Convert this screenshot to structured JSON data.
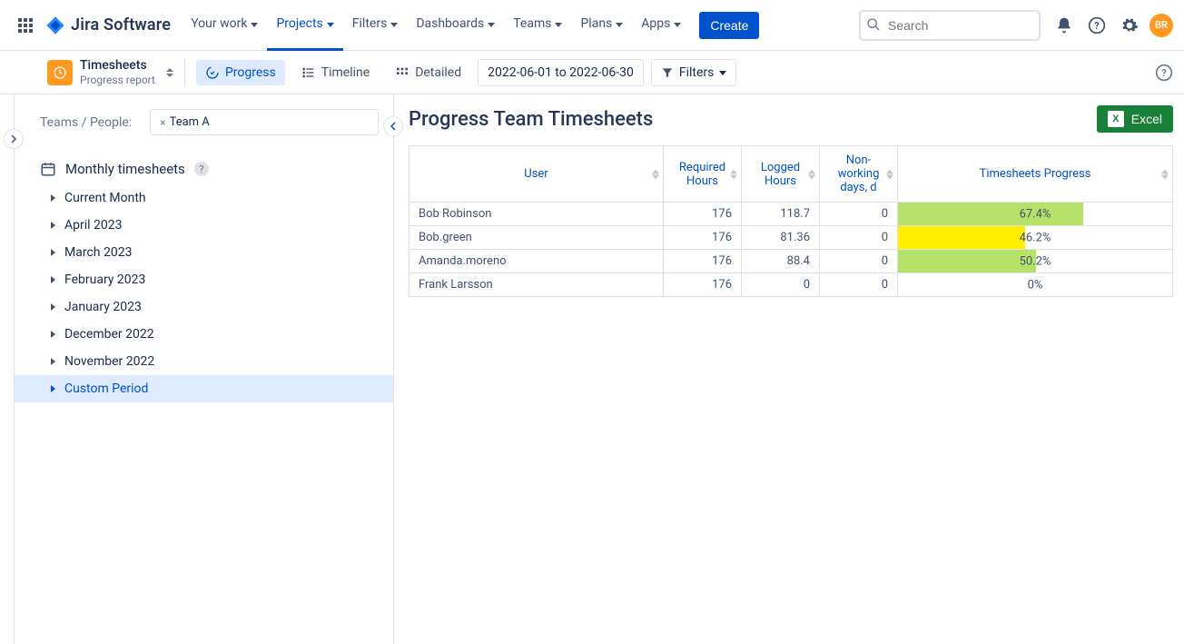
{
  "nav": {
    "product": "Jira Software",
    "items": [
      "Your work",
      "Projects",
      "Filters",
      "Dashboards",
      "Teams",
      "Plans",
      "Apps"
    ],
    "activeIndex": 1,
    "create": "Create",
    "searchPlaceholder": "Search",
    "avatar": "BR"
  },
  "subnav": {
    "projectTitle": "Timesheets",
    "projectSubtitle": "Progress report",
    "views": {
      "progress": "Progress",
      "timeline": "Timeline",
      "detailed": "Detailed"
    },
    "dateRange": "2022-06-01 to 2022-06-30",
    "filters": "Filters"
  },
  "sidebar": {
    "teamsLabel": "Teams / People:",
    "teamChip": "Team A",
    "monthlyTitle": "Monthly timesheets",
    "items": [
      "Current Month",
      "April 2023",
      "March 2023",
      "February 2023",
      "January 2023",
      "December 2022",
      "November 2022",
      "Custom Period"
    ],
    "selectedIndex": 7
  },
  "content": {
    "title": "Progress Team Timesheets",
    "excel": "Excel",
    "columns": {
      "user": "User",
      "required": "Required Hours",
      "logged": "Logged Hours",
      "nonworking": "Non-working days, d",
      "progress": "Timesheets Progress"
    },
    "rows": [
      {
        "user": "Bob Robinson",
        "required": "176",
        "logged": "118.7",
        "nonworking": "0",
        "progress": "67.4%",
        "pct": 67.4,
        "color": "#b6e26a"
      },
      {
        "user": "Bob.green",
        "required": "176",
        "logged": "81.36",
        "nonworking": "0",
        "progress": "46.2%",
        "pct": 46.2,
        "color": "#ffee00"
      },
      {
        "user": "Amanda.moreno",
        "required": "176",
        "logged": "88.4",
        "nonworking": "0",
        "progress": "50.2%",
        "pct": 50.2,
        "color": "#b6e26a"
      },
      {
        "user": "Frank Larsson",
        "required": "176",
        "logged": "0",
        "nonworking": "0",
        "progress": "0%",
        "pct": 0,
        "color": "#ffffff"
      }
    ]
  }
}
